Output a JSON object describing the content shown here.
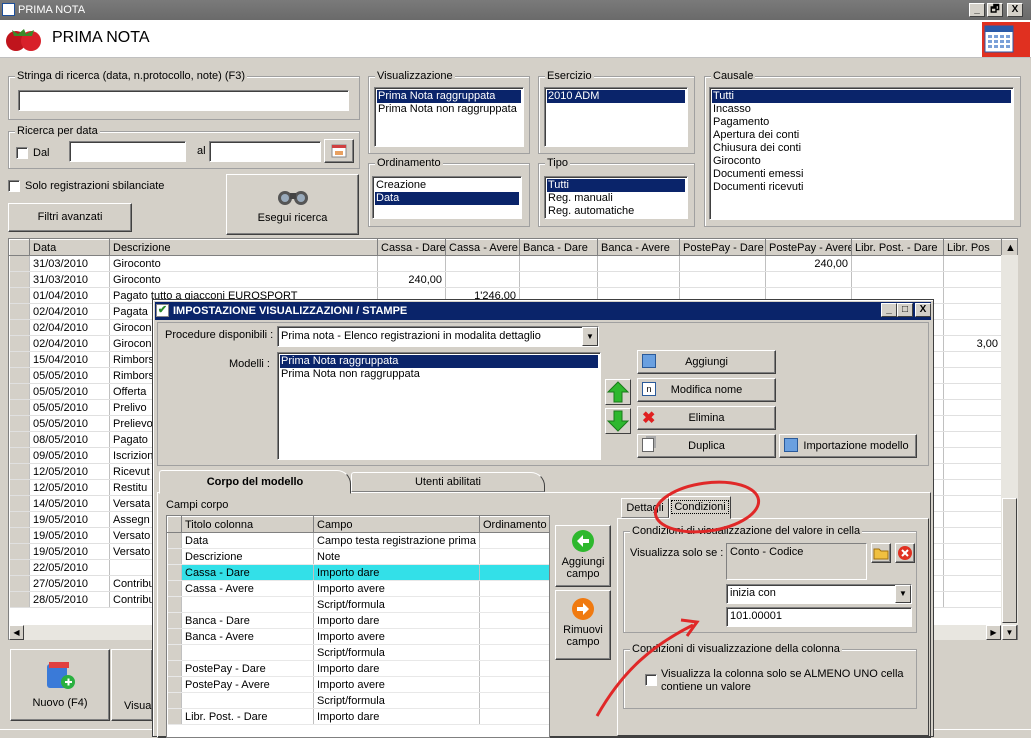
{
  "window": {
    "title": "PRIMA NOTA",
    "minimize": "_",
    "restore": "🗗",
    "close": "X"
  },
  "header": {
    "title": "PRIMA NOTA"
  },
  "search": {
    "label": "Stringa di ricerca (data, n.protocollo, note) (F3)",
    "value": ""
  },
  "date_search": {
    "label": "Ricerca per data",
    "dal": "Dal",
    "al": "al"
  },
  "solo_label": "Solo registrazioni sbilanciate",
  "filtri": "Filtri avanzati",
  "esegui": "Esegui ricerca",
  "visualizzazione": {
    "label": "Visualizzazione",
    "items": [
      "Prima Nota raggruppata",
      "Prima Nota non raggruppata"
    ]
  },
  "esercizio": {
    "label": "Esercizio",
    "items": [
      "2010 ADM"
    ]
  },
  "ordinamento": {
    "label": "Ordinamento",
    "items": [
      "Creazione",
      "Data"
    ]
  },
  "tipo": {
    "label": "Tipo",
    "items": [
      "Tutti",
      "Reg. manuali",
      "Reg. automatiche"
    ]
  },
  "causale": {
    "label": "Causale",
    "items": [
      "Tutti",
      "Incasso",
      "Pagamento",
      "Apertura dei conti",
      "Chiusura dei conti",
      "Giroconto",
      "Documenti emessi",
      "Documenti ricevuti"
    ]
  },
  "grid": {
    "headers": [
      "Data",
      "Descrizione",
      "Cassa - Dare",
      "Cassa - Avere",
      "Banca - Dare",
      "Banca - Avere",
      "PostePay - Dare",
      "PostePay - Avere",
      "Libr. Post. - Dare",
      "Libr. Pos"
    ],
    "rows": [
      [
        "31/03/2010",
        "Giroconto",
        "",
        "",
        "",
        "",
        "",
        "240,00",
        "",
        ""
      ],
      [
        "31/03/2010",
        "Giroconto",
        "240,00",
        "",
        "",
        "",
        "",
        "",
        "",
        ""
      ],
      [
        "01/04/2010",
        "Pagato tutto a giacconi EUROSPORT",
        "",
        "1'246,00",
        "",
        "",
        "",
        "",
        "",
        ""
      ],
      [
        "02/04/2010",
        "Pagata",
        "",
        "",
        "",
        "",
        "",
        "",
        "",
        ""
      ],
      [
        "02/04/2010",
        "Girocon",
        "",
        "",
        "",
        "",
        "",
        "",
        "",
        ""
      ],
      [
        "02/04/2010",
        "Girocon",
        "",
        "",
        "",
        "",
        "",
        "",
        "",
        "3,00"
      ],
      [
        "15/04/2010",
        "Rimbors",
        "",
        "",
        "",
        "",
        "",
        "",
        "",
        ""
      ],
      [
        "05/05/2010",
        "Rimbors",
        "",
        "",
        "",
        "",
        "",
        "",
        "",
        ""
      ],
      [
        "05/05/2010",
        "Offerta",
        "",
        "",
        "",
        "",
        "",
        "",
        "",
        ""
      ],
      [
        "05/05/2010",
        "Prelivo",
        "",
        "",
        "",
        "",
        "",
        "",
        "",
        ""
      ],
      [
        "05/05/2010",
        "Prelievo",
        "",
        "",
        "",
        "",
        "",
        "",
        "",
        ""
      ],
      [
        "08/05/2010",
        "Pagato",
        "",
        "",
        "",
        "",
        "",
        "",
        "",
        ""
      ],
      [
        "09/05/2010",
        "Iscrizion",
        "",
        "",
        "",
        "",
        "",
        "",
        "",
        ""
      ],
      [
        "12/05/2010",
        "Ricevut",
        "",
        "",
        "",
        "",
        "",
        "",
        "",
        ""
      ],
      [
        "12/05/2010",
        "Restitu",
        "",
        "",
        "",
        "",
        "",
        "",
        "",
        ""
      ],
      [
        "14/05/2010",
        "Versata",
        "",
        "",
        "",
        "",
        "",
        "",
        "",
        ""
      ],
      [
        "19/05/2010",
        "Assegn",
        "",
        "",
        "",
        "",
        "",
        "",
        "",
        ""
      ],
      [
        "19/05/2010",
        "Versato",
        "",
        "",
        "",
        "",
        "",
        "",
        "",
        ""
      ],
      [
        "19/05/2010",
        "Versato",
        "",
        "",
        "",
        "",
        "",
        "",
        "",
        ""
      ],
      [
        "22/05/2010",
        "",
        "",
        "",
        "",
        "",
        "",
        "",
        "",
        ""
      ],
      [
        "27/05/2010",
        "Contribu",
        "",
        "",
        "",
        "",
        "",
        "",
        "",
        ""
      ],
      [
        "28/05/2010",
        "Contribu",
        "",
        "",
        "",
        "",
        "",
        "",
        "",
        ""
      ]
    ]
  },
  "bottom": {
    "nuovo": "Nuovo (F4)",
    "visu": "Visua"
  },
  "dialog": {
    "title": "IMPOSTAZIONE VISUALIZZAZIONI / STAMPE",
    "proc_label": "Procedure disponibili :",
    "proc_value": "Prima nota - Elenco registrazioni in modalita dettaglio",
    "modelli_label": "Modelli :",
    "modelli": [
      "Prima Nota raggruppata",
      "Prima Nota non raggruppata"
    ],
    "aggiungi": "Aggiungi",
    "modifica": "Modifica nome",
    "elimina": "Elimina",
    "duplica": "Duplica",
    "importazione": "Importazione modello",
    "tab1": "Corpo del modello",
    "tab2": "Utenti abilitati",
    "campi_label": "Campi corpo",
    "cols": [
      "Titolo colonna",
      "Campo",
      "Ordinamento"
    ],
    "rows": [
      [
        "Data",
        "Campo testa registrazione prima ...",
        ""
      ],
      [
        "Descrizione",
        "Note",
        ""
      ],
      [
        "Cassa - Dare",
        "Importo dare",
        ""
      ],
      [
        "Cassa - Avere",
        "Importo avere",
        ""
      ],
      [
        "",
        "Script/formula",
        ""
      ],
      [
        "Banca - Dare",
        "Importo dare",
        ""
      ],
      [
        "Banca - Avere",
        "Importo avere",
        ""
      ],
      [
        "",
        "Script/formula",
        ""
      ],
      [
        "PostePay - Dare",
        "Importo dare",
        ""
      ],
      [
        "PostePay - Avere",
        "Importo avere",
        ""
      ],
      [
        "",
        "Script/formula",
        ""
      ],
      [
        "Libr. Post. - Dare",
        "Importo dare",
        ""
      ]
    ],
    "aggiungi_campo": "Aggiungi campo",
    "rimuovi_campo": "Rimuovi campo",
    "dettagli": "Dettagli",
    "condizioni": "Condizioni",
    "cond_cell_label": "Condizioni di visualizzazione del valore in cella",
    "vis_solo": "Visualizza solo se :",
    "field_value": "Conto - Codice",
    "operator": "inizia con",
    "value": "101.00001",
    "cond_col_label": "Condizioni di visualizzazione della colonna",
    "col_check": "Visualizza la colonna solo se ALMENO UNO cella contiene un valore"
  }
}
